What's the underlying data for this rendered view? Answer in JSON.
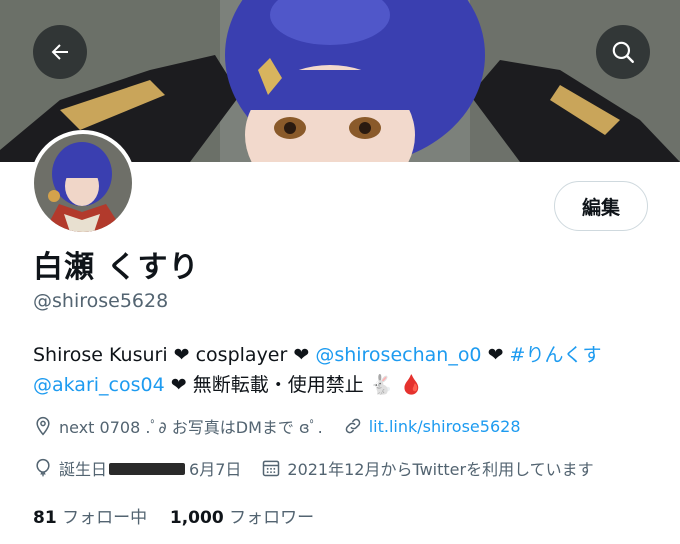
{
  "header": {
    "back_icon": "arrow-left-icon",
    "search_icon": "search-icon"
  },
  "profile": {
    "display_name": "白瀬 くすり",
    "handle": "@shirose5628",
    "edit_label": "編集"
  },
  "bio": {
    "text1": "Shirose Kusuri ❤ cosplayer ❤ ",
    "mention1": "@shirosechan_o0",
    "text2": " ❤ ",
    "hashtag": "#りんくす",
    "mention2": "@akari_cos04",
    "text3": " ❤ 無断転載・使用禁止 🐇 🩸"
  },
  "meta": {
    "location": "next 0708 .ﾟ∂ お写真はDMまで ɞﾟ.",
    "website": "lit.link/shirose5628",
    "birthday_prefix": "誕生日",
    "birthday_suffix": "6月7日",
    "joined": "2021年12月からTwitterを利用しています"
  },
  "stats": {
    "following_count": "81",
    "following_label": "フォロー中",
    "followers_count": "1,000",
    "followers_label": "フォロワー"
  },
  "colors": {
    "link": "#1d9bf0",
    "secondary_text": "#536471",
    "primary_text": "#0f1419",
    "hair": "#3a3fb0"
  }
}
